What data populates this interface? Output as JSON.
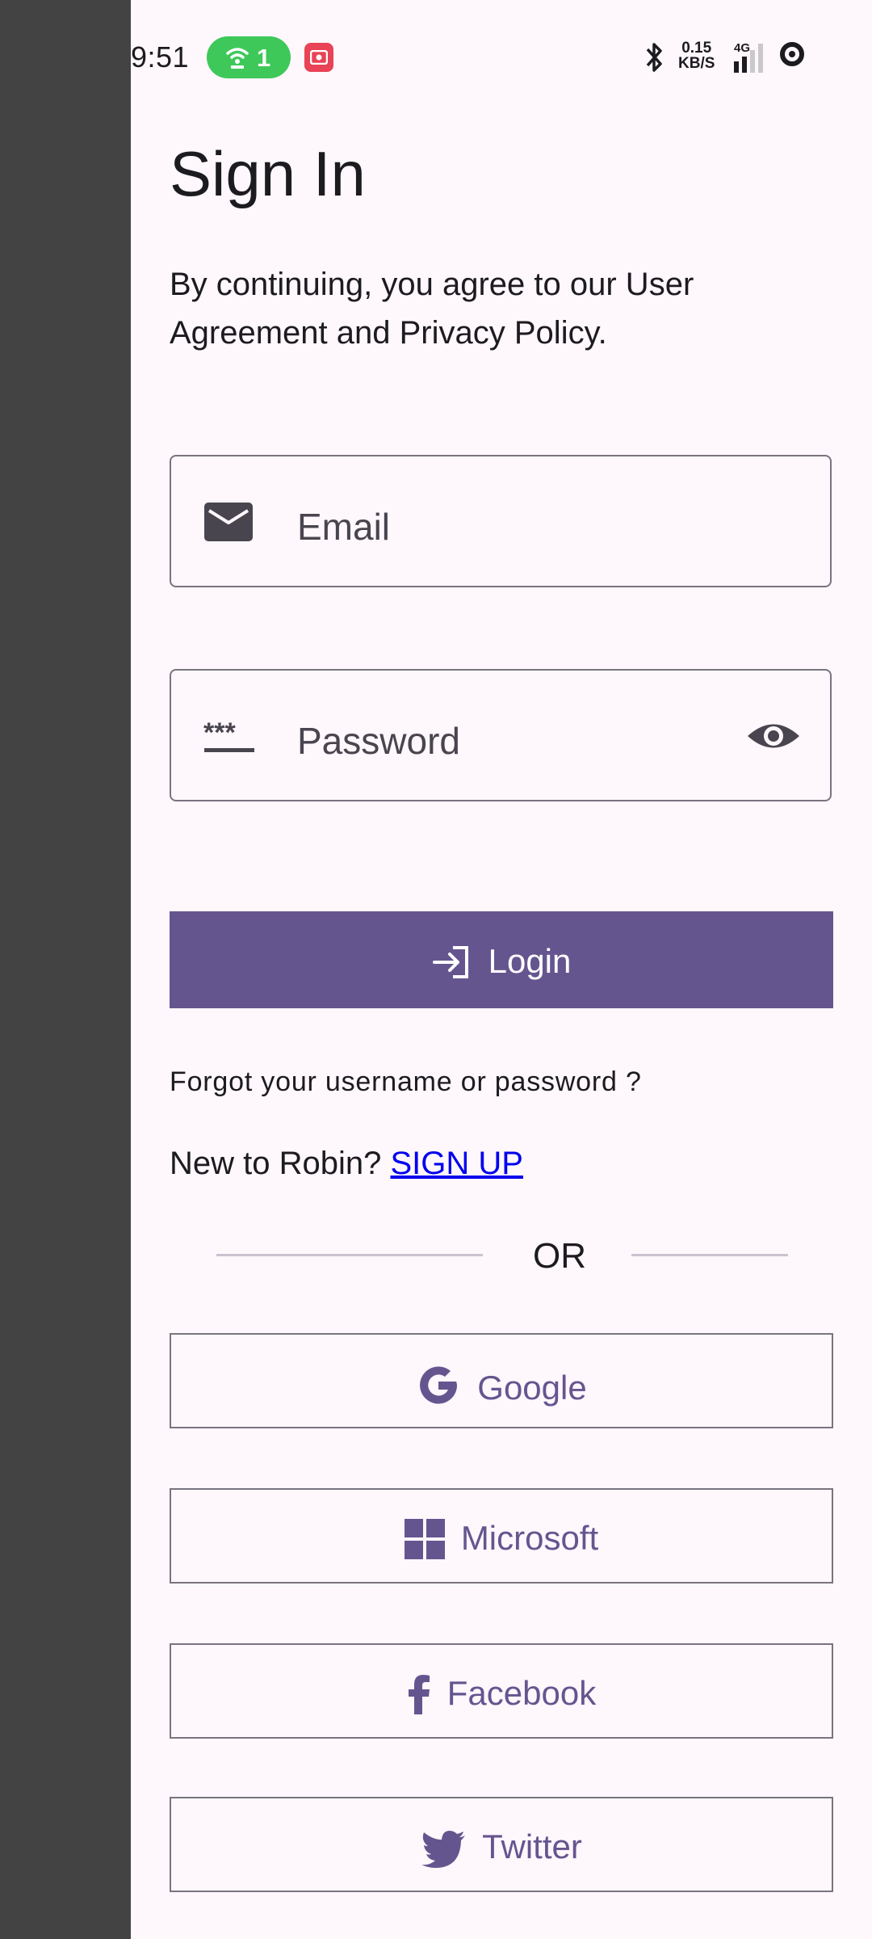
{
  "status_bar": {
    "time": "9:51",
    "hotspot_count": "1",
    "speed_value": "0.15",
    "speed_unit": "KB/S",
    "network": "4G"
  },
  "page": {
    "title": "Sign In",
    "subtitle": "By continuing, you agree to our User Agreement and Privacy Policy."
  },
  "form": {
    "email_placeholder": "Email",
    "password_placeholder": "Password",
    "login_label": "Login"
  },
  "links": {
    "forgot": "Forgot your username or password ?",
    "new_to": "New to Robin?",
    "signup": "SIGN UP"
  },
  "divider": {
    "or": "OR"
  },
  "social": {
    "google": "Google",
    "microsoft": "Microsoft",
    "facebook": "Facebook",
    "twitter": "Twitter"
  },
  "colors": {
    "primary": "#65558f",
    "background": "#fef7fc",
    "outline": "#79747e",
    "left_strip": "#434343",
    "link": "#0000ee"
  }
}
